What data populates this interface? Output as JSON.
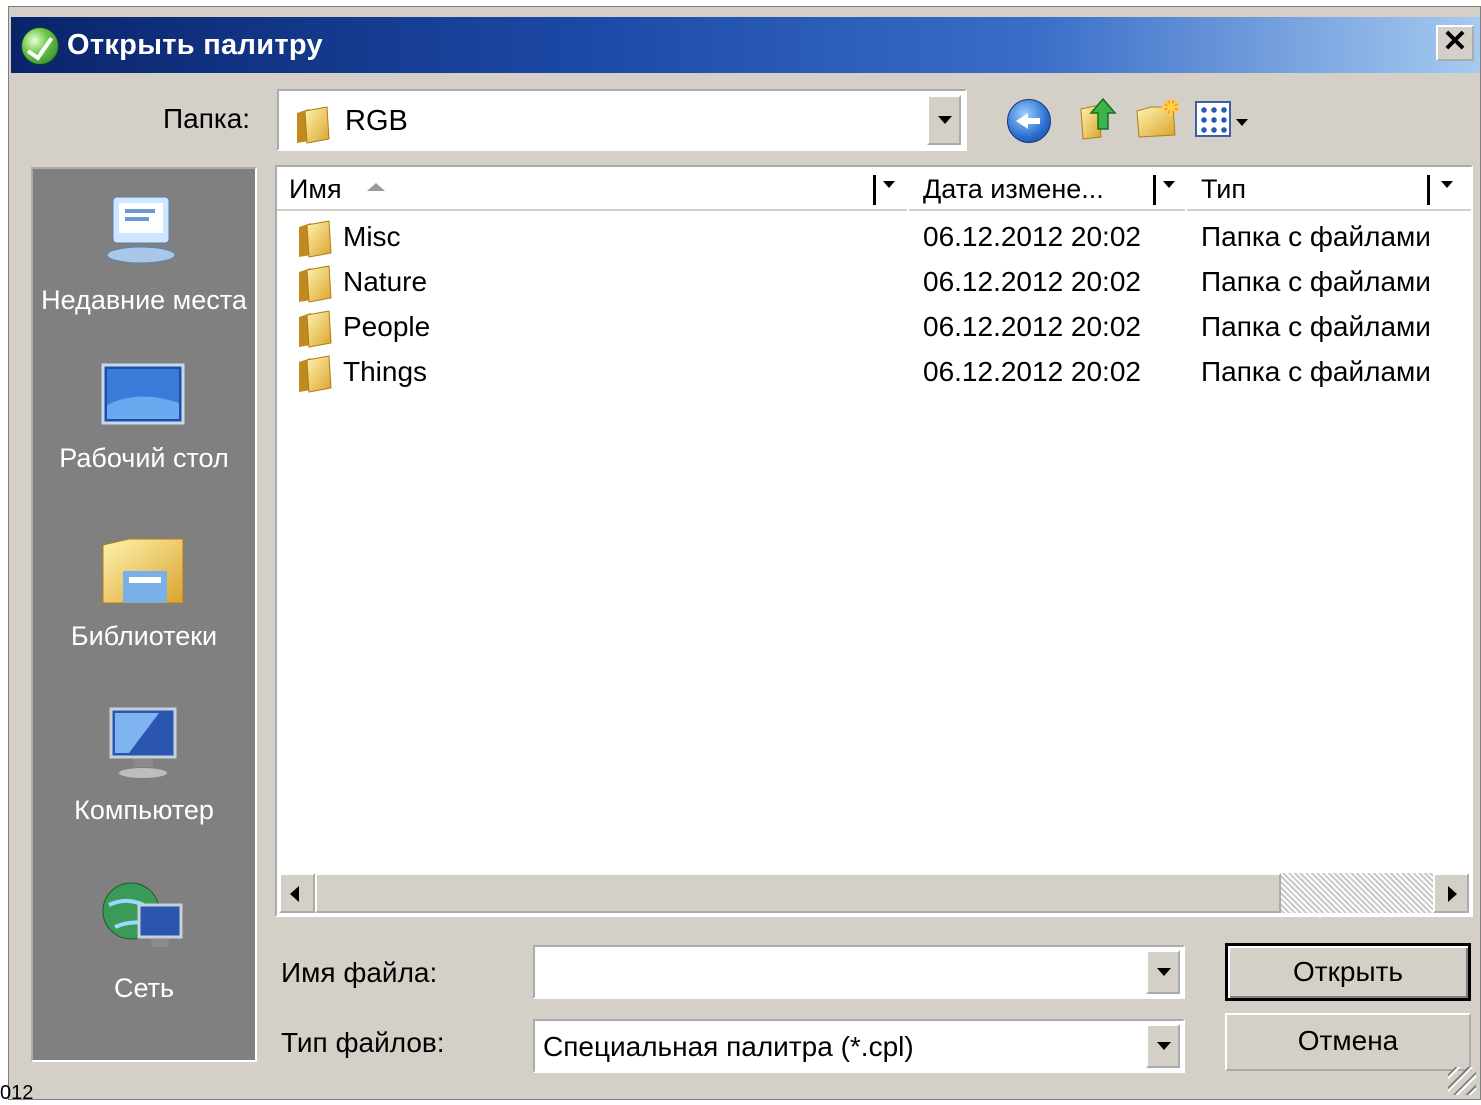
{
  "window": {
    "title": "Открыть палитру",
    "close_label": "✕"
  },
  "lookin": {
    "label": "Папка:",
    "value": "RGB"
  },
  "toolbar": {
    "back": "back-icon",
    "up": "up-folder-icon",
    "new_folder": "new-folder-icon",
    "views": "views-menu-icon"
  },
  "places": [
    {
      "label": "Недавние места",
      "icon": "recent-places-icon"
    },
    {
      "label": "Рабочий стол",
      "icon": "desktop-icon"
    },
    {
      "label": "Библиотеки",
      "icon": "libraries-icon"
    },
    {
      "label": "Компьютер",
      "icon": "computer-icon"
    },
    {
      "label": "Сеть",
      "icon": "network-icon"
    }
  ],
  "columns": [
    "Имя",
    "Дата измене...",
    "Тип"
  ],
  "files": [
    {
      "name": "Misc",
      "date": "06.12.2012 20:02",
      "type": "Папка с файлами"
    },
    {
      "name": "Nature",
      "date": "06.12.2012 20:02",
      "type": "Папка с файлами"
    },
    {
      "name": "People",
      "date": "06.12.2012 20:02",
      "type": "Папка с файлами"
    },
    {
      "name": "Things",
      "date": "06.12.2012 20:02",
      "type": "Папка с файлами"
    }
  ],
  "filename": {
    "label": "Имя файла:",
    "value": ""
  },
  "filetype": {
    "label": "Тип файлов:",
    "value": "Специальная палитра (*.cpl)"
  },
  "buttons": {
    "open": "Открыть",
    "cancel": "Отмена"
  },
  "stray_text": "012",
  "colors": {
    "title_start": "#0a246a",
    "title_end": "#a6caf0",
    "dialog_bg": "#d4d0c8",
    "places_bg": "#808080"
  }
}
